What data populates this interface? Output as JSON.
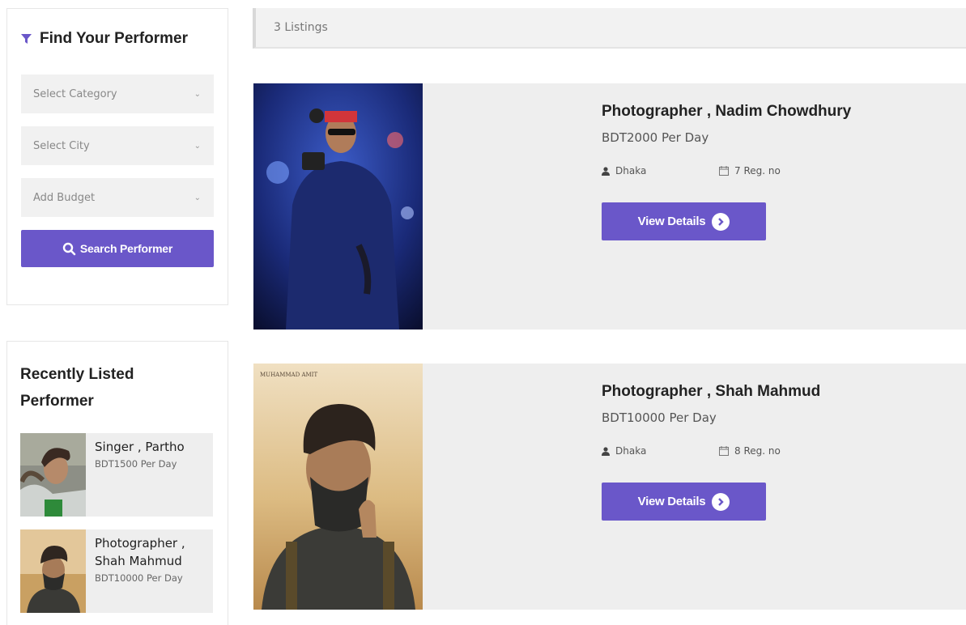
{
  "sidebar": {
    "filter_title": "Find Your Performer",
    "category_placeholder": "Select Category",
    "city_placeholder": "Select City",
    "budget_placeholder": "Add Budget",
    "search_button": "Search Performer",
    "recent_title": "Recently Listed Performer",
    "recent_items": [
      {
        "name": "Singer , Partho",
        "price": "BDT1500 Per Day"
      },
      {
        "name": "Photographer , Shah Mahmud",
        "price": "BDT10000 Per Day"
      }
    ]
  },
  "listings": {
    "count_label": "3 Listings",
    "items": [
      {
        "title": "Photographer , Nadim Chowdhury",
        "price": "BDT2000 Per Day",
        "location": "Dhaka",
        "reg": "7 Reg. no",
        "button": "View Details"
      },
      {
        "title": "Photographer , Shah Mahmud",
        "price": "BDT10000 Per Day",
        "location": "Dhaka",
        "reg": "8 Reg. no",
        "button": "View Details",
        "watermark": "MUHAMMAD AMIT"
      }
    ]
  },
  "colors": {
    "accent": "#6a57c9",
    "card_bg": "#eeeeee",
    "select_bg": "#f1f1f1"
  }
}
